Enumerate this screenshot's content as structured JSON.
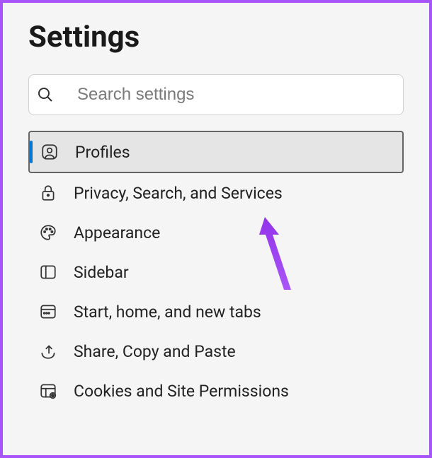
{
  "header": {
    "title": "Settings"
  },
  "search": {
    "placeholder": "Search settings"
  },
  "nav": {
    "items": [
      {
        "label": "Profiles",
        "icon": "profile-icon",
        "active": true
      },
      {
        "label": "Privacy, Search, and Services",
        "icon": "lock-icon",
        "active": false
      },
      {
        "label": "Appearance",
        "icon": "palette-icon",
        "active": false
      },
      {
        "label": "Sidebar",
        "icon": "sidebar-icon",
        "active": false
      },
      {
        "label": "Start, home, and new tabs",
        "icon": "tabs-icon",
        "active": false
      },
      {
        "label": "Share, Copy and Paste",
        "icon": "share-icon",
        "active": false
      },
      {
        "label": "Cookies and Site Permissions",
        "icon": "cookies-icon",
        "active": false
      }
    ]
  }
}
